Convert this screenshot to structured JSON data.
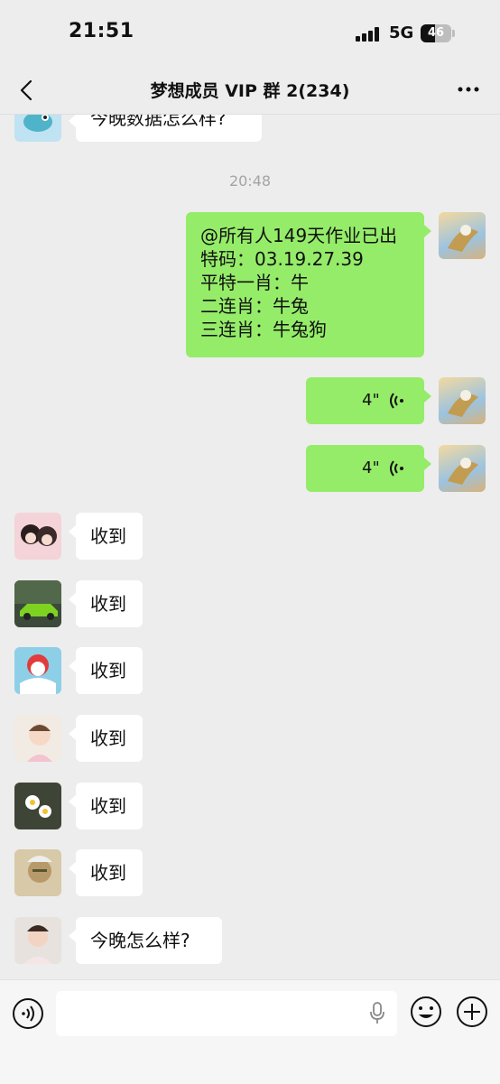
{
  "status_bar": {
    "time": "21:51",
    "network": "5G",
    "battery": "46",
    "battery_level": 0.46
  },
  "nav": {
    "title": "梦想成员 VIP 群 2(234)"
  },
  "messages": [
    {
      "text": "今晚数据怎么样?"
    },
    {
      "timestamp": "20:48"
    },
    {
      "lines": [
        "@所有人149天作业已出",
        "特码：03.19.27.39",
        "平特一肖：牛",
        "二连肖：牛兔",
        "三连肖：牛兔狗"
      ]
    },
    {
      "voice_duration": "4\""
    },
    {
      "voice_duration": "4\""
    },
    {
      "text": "收到"
    },
    {
      "text": "收到"
    },
    {
      "text": "收到"
    },
    {
      "text": "收到"
    },
    {
      "text": "收到"
    },
    {
      "text": "收到"
    },
    {
      "text": "今晚怎么样?"
    }
  ],
  "icons": {
    "back": "chevron-left-icon",
    "more": "more-dots-icon",
    "voice_mode": "voice-icon",
    "mic": "microphone-icon",
    "emoji": "emoji-icon",
    "add": "plus-icon"
  },
  "colors": {
    "chat_bg": "#ededed",
    "out_bubble": "#95ec69",
    "in_bubble": "#ffffff"
  }
}
